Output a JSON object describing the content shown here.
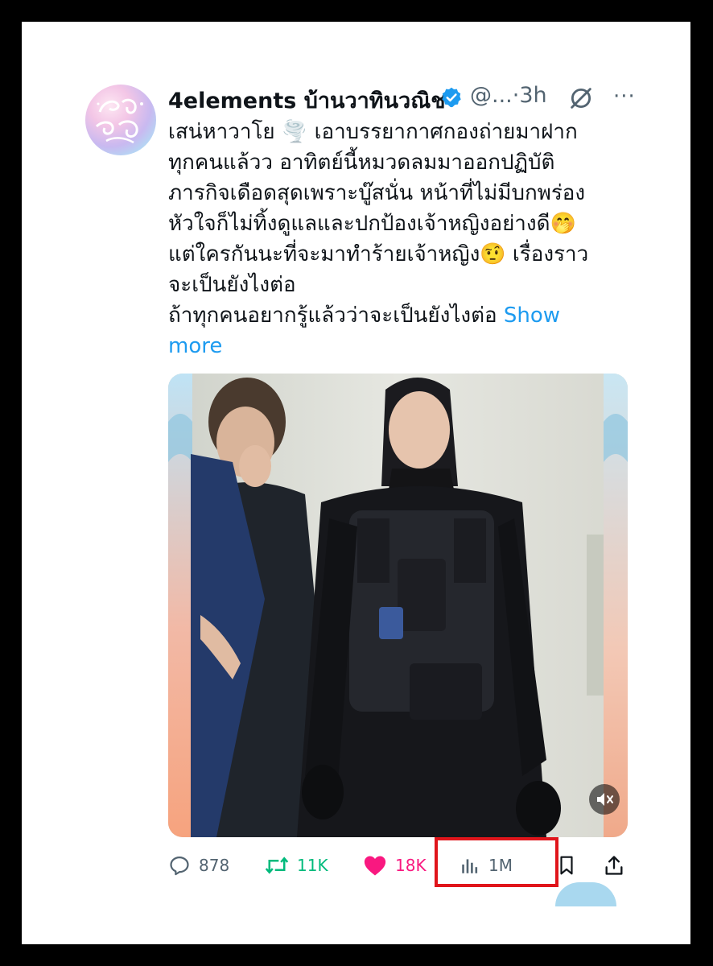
{
  "tweet": {
    "display_name": "4elements บ้านวาทินวณิช",
    "handle": "@...",
    "separator": "·",
    "time": "3h",
    "more_label": "···",
    "text": "เสน่หาวาโย 🌪️ เอาบรรยากาศกองถ่ายมาฝาก\nทุกคนแล้วว อาทิตย์นี้หมวดลมมาออกปฏิบัติ\nภารกิจเดือดสุดเพราะบู๊สนั่น หน้าที่ไม่มีบกพร่อง\nหัวใจก็ไม่ทิ้งดูแลและปกป้องเจ้าหญิงอย่างดี🤭\nแต่ใครกันนะที่จะมาทำร้ายเจ้าหญิง🤨 เรื่องราว\nจะเป็นยังไงต่อ\nถ้าทุกคนอยากรู้แล้วว่าจะเป็นยังไงต่อ ",
    "show_more": "Show\nmore"
  },
  "actions": {
    "replies": "878",
    "retweets": "11K",
    "likes": "18K",
    "views": "1M"
  },
  "icons": {
    "verified": "verified-badge-icon",
    "grok": "grok-icon",
    "reply": "reply-icon",
    "retweet": "retweet-icon",
    "like": "heart-icon",
    "views": "views-bar-chart-icon",
    "bookmark": "bookmark-icon",
    "share": "share-icon",
    "mute": "mute-icon"
  },
  "colors": {
    "accent": "#1d9bf0",
    "retweet": "#00ba7c",
    "like": "#f91880",
    "muted_text": "#536471",
    "highlight_box": "#e0151b"
  }
}
